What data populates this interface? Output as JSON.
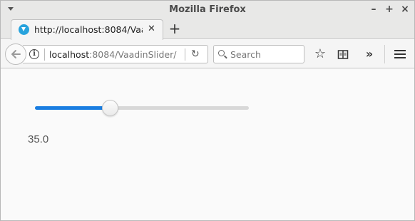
{
  "window": {
    "title": "Mozilla Firefox"
  },
  "tab": {
    "title": "http://localhost:8084/VaadinSlider/",
    "favicon": "vaadin-icon"
  },
  "navbar": {
    "url_host": "localhost",
    "url_rest": ":8084/VaadinSlider/",
    "search_placeholder": "Search"
  },
  "slider": {
    "min": 0,
    "max": 100,
    "value": 35.0,
    "value_label": "35.0",
    "accent": "#197de1"
  }
}
